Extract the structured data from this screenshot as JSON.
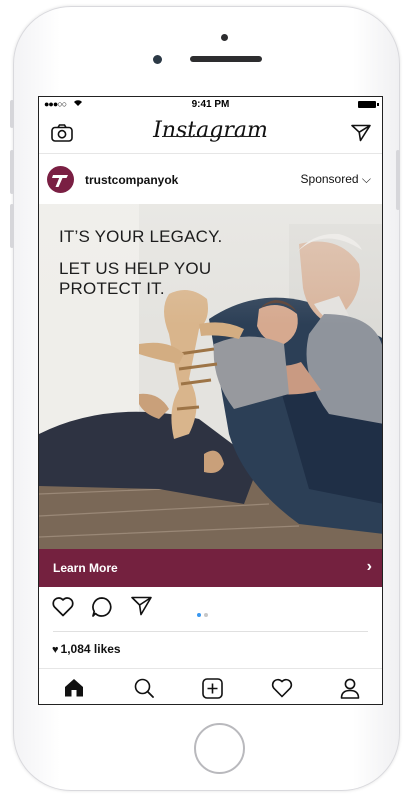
{
  "status_bar": {
    "signal": "●●●○○",
    "wifi_icon": "wifi-icon",
    "time": "9:41 PM"
  },
  "header": {
    "app_name": "Instagram",
    "left_icon": "camera-icon",
    "right_icon": "direct-message-icon"
  },
  "post": {
    "username": "trustcompanyok",
    "sponsored_label": "Sponsored ⌵",
    "headline_line1": "IT’S YOUR LEGACY.",
    "headline_line2": "LET US HELP YOU PROTECT IT.",
    "cta_label": "Learn More",
    "cta_chevron": "›",
    "likes": "1,084 likes",
    "carousel": {
      "count": 2,
      "active_index": 0
    },
    "colors": {
      "brand": "#74213f",
      "active_dot": "#3897f0",
      "inactive_dot": "#c7c7c7"
    }
  },
  "actions": [
    "like-icon",
    "comment-icon",
    "share-icon"
  ],
  "tabbar": [
    "home-icon",
    "search-icon",
    "new-post-icon",
    "activity-icon",
    "profile-icon"
  ]
}
